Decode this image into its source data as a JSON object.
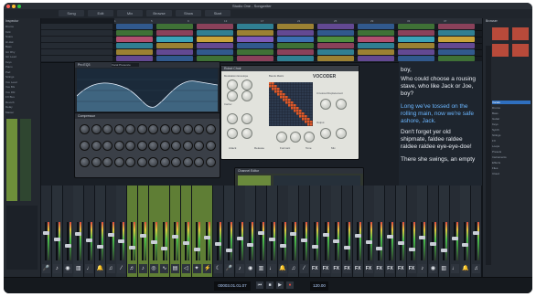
{
  "window": {
    "title": "Studio One - Songwriter",
    "traffic_lights": [
      "#ff5f57",
      "#febc2e",
      "#28c840"
    ]
  },
  "toolbar": {
    "buttons": [
      "Song",
      "Edit",
      "Mix",
      "Browse",
      "Show",
      "Start"
    ]
  },
  "left_panel": {
    "header": "Inspector",
    "items": [
      "Drums",
      "Kick",
      "Snare",
      "Hi-Hat",
      "Bass",
      "Gtr Rhy",
      "Gtr Lead",
      "Keys",
      "Piano",
      "Pad",
      "Strings",
      "Vox Lead",
      "Vox BG",
      "Vox Dbl",
      "FX Bus",
      "Reverb",
      "Delay",
      "Master"
    ]
  },
  "tracks": {
    "lanes": 6,
    "ruler_marks": [
      "1",
      "5",
      "9",
      "13",
      "17",
      "21",
      "25",
      "29",
      "33",
      "37"
    ]
  },
  "plugins": {
    "eq": {
      "title": "Pro EQ3",
      "preset": "Vocal Presence"
    },
    "compressor": {
      "title": "Compressor"
    },
    "vocoder": {
      "title": "VOCODER",
      "preset": "Robot Choir",
      "sections": [
        "Modulation Envelope",
        "Bands Matrix",
        "Carrier",
        "Unvoiced Replacement",
        "Output"
      ],
      "labels": [
        "Attack",
        "Release",
        "Formant",
        "Tone",
        "Mix"
      ]
    },
    "channel": {
      "title": "Channel Editor"
    }
  },
  "lyrics": {
    "lines": [
      {
        "text": "boy,",
        "color": "#e8ecf2"
      },
      {
        "text": "Who could choose a rousing",
        "color": "#e8ecf2"
      },
      {
        "text": "stave, who like Jack or Joe,",
        "color": "#e8ecf2"
      },
      {
        "text": "boy?",
        "color": "#e8ecf2"
      },
      {
        "text": "Long we've tossed on the",
        "color": "#6bb6ff"
      },
      {
        "text": "rolling main, now we're safe",
        "color": "#6bb6ff"
      },
      {
        "text": "ashore, Jack.",
        "color": "#6bb6ff"
      },
      {
        "text": "Don't forget yer old",
        "color": "#e8ecf2"
      },
      {
        "text": "shipmate, faldee raldee",
        "color": "#e8ecf2"
      },
      {
        "text": "raldee raldee eye-eye-doe!",
        "color": "#e8ecf2"
      },
      {
        "text": "There she swings, an empty",
        "color": "#e8ecf2"
      }
    ]
  },
  "right_panel": {
    "header": "Browser",
    "items": [
      "Vocals",
      "Drums",
      "Bass",
      "Guitar",
      "Keys",
      "Synth",
      "Strings",
      "FX",
      "Loops",
      "Presets",
      "Instruments",
      "Effects",
      "Files",
      "Cloud"
    ]
  },
  "mixer": {
    "strip_count": 41,
    "icons": [
      "mic",
      "guitar",
      "drum",
      "keys",
      "bass",
      "bell",
      "note",
      "flute",
      "violin",
      "sax",
      "cymbal",
      "wave",
      "piano",
      "horn",
      "sparkle",
      "bolt",
      "moon"
    ],
    "fx_label": "FX"
  },
  "transport": {
    "time": "00003.01.01.07",
    "tempo": "120.00"
  }
}
